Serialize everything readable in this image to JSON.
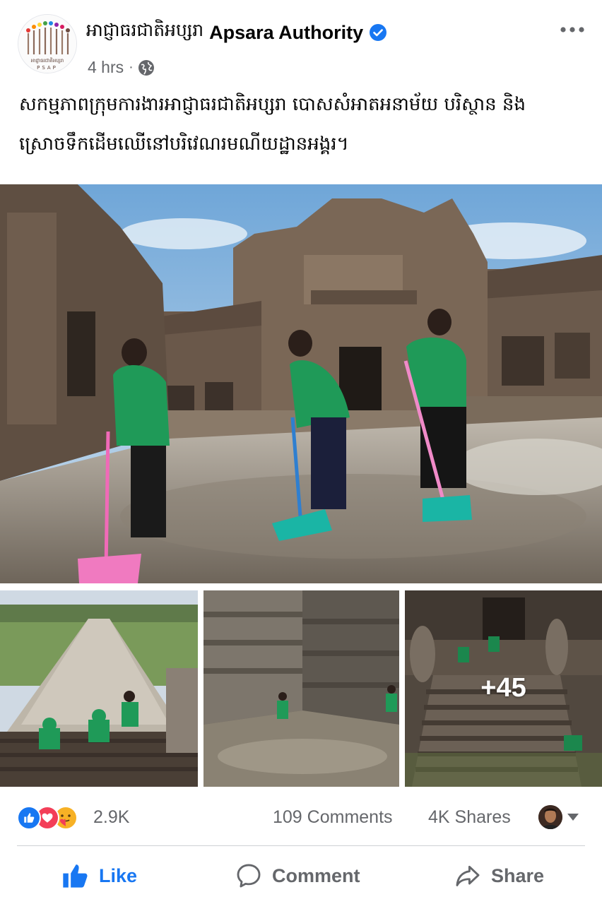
{
  "post": {
    "page_name_km": "អាជ្ញាធរជាតិអប្សរា",
    "page_name_en": "Apsara Authority",
    "timestamp": "4 hrs",
    "separator": "·",
    "audience_icon": "globe-icon",
    "verified_icon": "verified-badge-icon",
    "avatar_caption": "អាជ្ញាធរជាតិអប្សរា",
    "avatar_subcaption": "PSAP",
    "text_line1": "សកម្មភាពក្រុមការងារអាជ្ញាធរជាតិអប្សរា បោសសំអាតអនាម័យ បរិស្ថាន និង",
    "text_line2": "ស្រោចទឹកដើមឈើនៅបរិវេណរមណីយដ្ឋានអង្គរ។"
  },
  "photos": {
    "more_count": "+45"
  },
  "stats": {
    "reactions": [
      "like",
      "love",
      "care"
    ],
    "reaction_count": "2.9K",
    "comments": "109 Comments",
    "shares": "4K Shares"
  },
  "actions": {
    "like": "Like",
    "comment": "Comment",
    "share": "Share"
  },
  "colors": {
    "accent": "#1877f2",
    "secondary_text": "#65676b",
    "love": "#f33e58",
    "care": "#f7b125"
  }
}
